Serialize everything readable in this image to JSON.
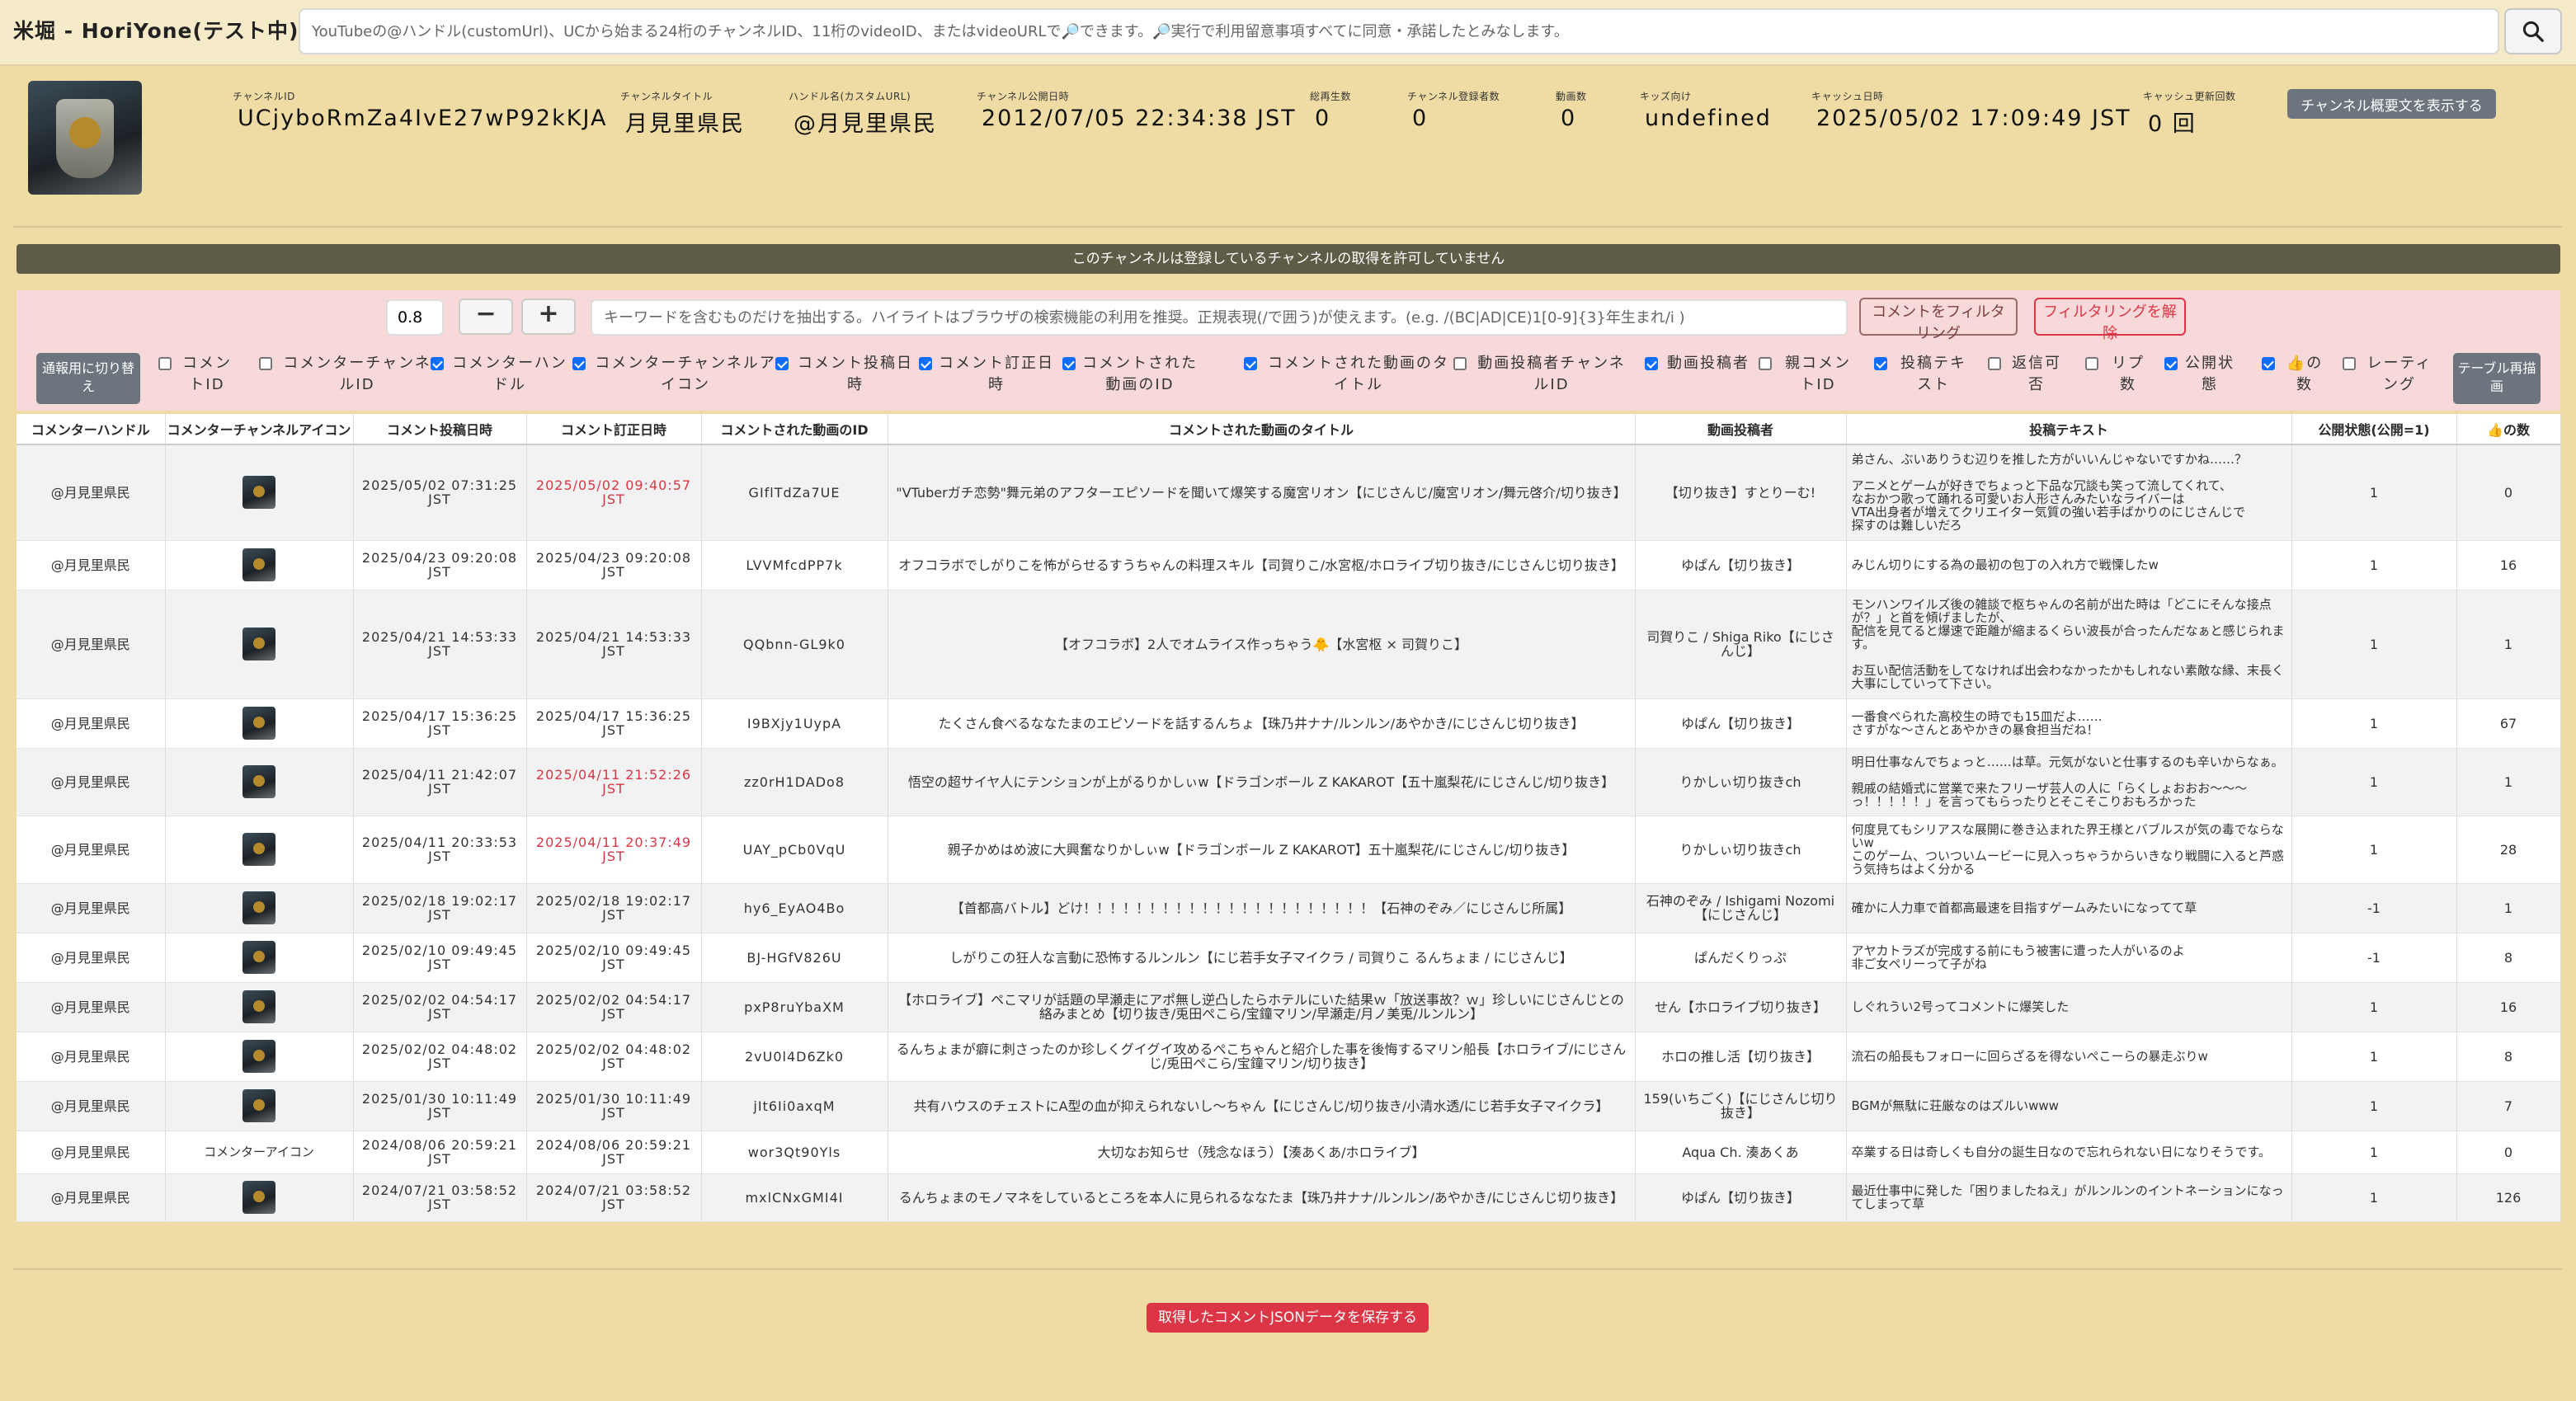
{
  "app": {
    "title": "米堀 - HoriYone(テスト中)"
  },
  "search": {
    "placeholder": "YouTubeの@ハンドル(customUrl)、UCから始まる24桁のチャンネルID、11桁のvideoID、またはvideoURLで🔎できます。🔎実行で利用留意事項すべてに同意・承諾したとみなします。",
    "button_icon": "search-icon"
  },
  "channel": {
    "avatar_icon": "channel-avatar",
    "fields": [
      {
        "label": "チャンネルID",
        "value": "UCjyboRmZa4IvE27wP92kKJA"
      },
      {
        "label": "チャンネルタイトル",
        "value": "月見里県民"
      },
      {
        "label": "ハンドル名(カスタムURL)",
        "value": "@月見里県民"
      },
      {
        "label": "チャンネル公開日時",
        "value": "2012/07/05 22:34:38 JST"
      },
      {
        "label": "総再生数",
        "value": "0"
      },
      {
        "label": "チャンネル登録者数",
        "value": "0"
      },
      {
        "label": "動画数",
        "value": "0"
      },
      {
        "label": "キッズ向け",
        "value": "undefined"
      },
      {
        "label": "キャッシュ日時",
        "value": "2025/05/02 17:09:49 JST"
      },
      {
        "label": "キャッシュ更新回数",
        "value": "0 回"
      }
    ],
    "overview_button": "チャンネル概要文を表示する"
  },
  "notice": "このチャンネルは登録しているチャンネルの取得を許可していません",
  "filter": {
    "ratio_value": "0.8",
    "minus_label": "−",
    "plus_label": "+",
    "keyword_placeholder": "キーワードを含むものだけを抽出する。ハイライトはブラウザの検索機能の利用を推奨。正規表現(/で囲う)が使えます。(e.g. /(BC|AD|CE)1[0-9]{3}年生まれ/i )",
    "apply_button": "コメントをフィルタリング",
    "clear_button": "フィルタリングを解除",
    "mobile_button": "通報用に切り替え",
    "redraw_button": "テーブル再描画"
  },
  "column_toggles": [
    {
      "label": "コメントID",
      "checked": false
    },
    {
      "label": "コメンターチャンネルID",
      "checked": false
    },
    {
      "label": "コメンターハンドル",
      "checked": true
    },
    {
      "label": "コメンターチャンネルアイコン",
      "checked": true
    },
    {
      "label": "コメント投稿日時",
      "checked": true
    },
    {
      "label": "コメント訂正日時",
      "checked": true
    },
    {
      "label": "コメントされた動画のID",
      "checked": true
    },
    {
      "label": "コメントされた動画のタイトル",
      "checked": true
    },
    {
      "label": "動画投稿者チャンネルID",
      "checked": false
    },
    {
      "label": "動画投稿者",
      "checked": true
    },
    {
      "label": "親コメントID",
      "checked": false
    },
    {
      "label": "投稿テキスト",
      "checked": true
    },
    {
      "label": "返信可否",
      "checked": false
    },
    {
      "label": "リプ数",
      "checked": false
    },
    {
      "label": "公開状態",
      "checked": true
    },
    {
      "label": "👍の数",
      "checked": true
    },
    {
      "label": "レーティング",
      "checked": false
    }
  ],
  "table": {
    "headers": [
      "コメンターハンドル",
      "コメンターチャンネルアイコン",
      "コメント投稿日時",
      "コメント訂正日時",
      "コメントされた動画のID",
      "コメントされた動画のタイトル",
      "動画投稿者",
      "投稿テキスト",
      "公開状態(公開=1)",
      "👍の数"
    ],
    "rows": [
      {
        "handle": "@月見里県民",
        "icon": "commenter-icon",
        "posted": "2025/05/02 07:31:25 JST",
        "edited": "2025/05/02 09:40:57 JST",
        "edited_changed": true,
        "video_id": "GIflTdZa7UE",
        "title": "\"VTuberガチ恋勢\"舞元弟のアフターエピソードを聞いて爆笑する魔宮リオン【にじさんじ/魔宮リオン/舞元啓介/切り抜き】",
        "uploader": "【切り抜き】すとりーむ!",
        "text": "弟さん、ぶいありうむ辺りを推した方がいいんじゃないですかね……？\n\nアニメとゲームが好きでちょっと下品な冗談も笑って流してくれて、\nなおかつ歌って踊れる可愛いお人形さんみたいなライバーは\nVTA出身者が増えてクリエイター気質の強い若手ばかりのにじさんじで\n探すのは難しいだろ",
        "status": "1",
        "likes": "0"
      },
      {
        "handle": "@月見里県民",
        "icon": "commenter-icon",
        "posted": "2025/04/23 09:20:08 JST",
        "edited": "2025/04/23 09:20:08 JST",
        "edited_changed": false,
        "video_id": "LVVMfcdPP7k",
        "title": "オフコラボでしがりこを怖がらせるすうちゃんの料理スキル【司賀りこ/水宮枢/ホロライブ切り抜き/にじさんじ切り抜き】",
        "uploader": "ゆぱん【切り抜き】",
        "text": "みじん切りにする為の最初の包丁の入れ方で戦慄したw",
        "status": "1",
        "likes": "16"
      },
      {
        "handle": "@月見里県民",
        "icon": "commenter-icon",
        "posted": "2025/04/21 14:53:33 JST",
        "edited": "2025/04/21 14:53:33 JST",
        "edited_changed": false,
        "video_id": "QQbnn-GL9k0",
        "title": "【オフコラボ】2人でオムライス作っちゃう🐥【水宮枢 × 司賀りこ】",
        "uploader": "司賀りこ / Shiga Riko【にじさんじ】",
        "text": "モンハンワイルズ後の雑談で枢ちゃんの名前が出た時は「どこにそんな接点が？」と首を傾げましたが、\n配信を見てると爆速で距離が縮まるくらい波長が合ったんだなぁと感じられます。\n\nお互い配信活動をしてなければ出会わなかったかもしれない素敵な縁、末長く大事にしていって下さい。",
        "status": "1",
        "likes": "1"
      },
      {
        "handle": "@月見里県民",
        "icon": "commenter-icon",
        "posted": "2025/04/17 15:36:25 JST",
        "edited": "2025/04/17 15:36:25 JST",
        "edited_changed": false,
        "video_id": "I9BXjy1UypA",
        "title": "たくさん食べるななたまのエピソードを話するんちょ【珠乃井ナナ/ルンルン/あやかき/にじさんじ切り抜き】",
        "uploader": "ゆぱん【切り抜き】",
        "text": "一番食べられた高校生の時でも15皿だよ……\nさすがな～さんとあやかきの暴食担当だね！",
        "status": "1",
        "likes": "67"
      },
      {
        "handle": "@月見里県民",
        "icon": "commenter-icon",
        "posted": "2025/04/11 21:42:07 JST",
        "edited": "2025/04/11 21:52:26 JST",
        "edited_changed": true,
        "video_id": "zz0rH1DADo8",
        "title": "悟空の超サイヤ人にテンションが上がるりかしぃw【ドラゴンボール Z KAKAROT【五十嵐梨花/にじさんじ/切り抜き】",
        "uploader": "りかしぃ切り抜きch",
        "text": "明日仕事なんでちょっと……は草。元気がないと仕事するのも辛いからなぁ。\n\n親戚の結婚式に営業で来たフリーザ芸人の人に「らくしょおおお～～～っ！！！！！」を言ってもらったりとそこそこりおもろかった",
        "status": "1",
        "likes": "1"
      },
      {
        "handle": "@月見里県民",
        "icon": "commenter-icon",
        "posted": "2025/04/11 20:33:53 JST",
        "edited": "2025/04/11 20:37:49 JST",
        "edited_changed": true,
        "video_id": "UAY_pCb0VqU",
        "title": "親子かめはめ波に大興奮なりかしぃw【ドラゴンボール Z KAKAROT】五十嵐梨花/にじさんじ/切り抜き】",
        "uploader": "りかしぃ切り抜きch",
        "text": "何度見てもシリアスな展開に巻き込まれた界王様とバブルスが気の毒でならないw\nこのゲーム、ついついムービーに見入っちゃうからいきなり戦闘に入ると芦惑う気持ちはよく分かる",
        "status": "1",
        "likes": "28"
      },
      {
        "handle": "@月見里県民",
        "icon": "commenter-icon",
        "posted": "2025/02/18 19:02:17 JST",
        "edited": "2025/02/18 19:02:17 JST",
        "edited_changed": false,
        "video_id": "hy6_EyAO4Bo",
        "title": "【首都高バトル】どけ！！！！！！！！！！！！！！！！！！！！！！【石神のぞみ／にじさんじ所属】",
        "uploader": "石神のぞみ / Ishigami Nozomi【にじさんじ】",
        "text": "確かに人力車で首都高最速を目指すゲームみたいになってて草",
        "status": "-1",
        "likes": "1"
      },
      {
        "handle": "@月見里県民",
        "icon": "commenter-icon",
        "posted": "2025/02/10 09:49:45 JST",
        "edited": "2025/02/10 09:49:45 JST",
        "edited_changed": false,
        "video_id": "BJ-HGfV826U",
        "title": "しがりこの狂人な言動に恐怖するルンルン【にじ若手女子マイクラ / 司賀りこ るんちょま / にじさんじ】",
        "uploader": "ぱんだくりっぷ",
        "text": "アヤカトラズが完成する前にもう被害に遭った人がいるのよ\n非ご女ペリーって子がね",
        "status": "-1",
        "likes": "8"
      },
      {
        "handle": "@月見里県民",
        "icon": "commenter-icon",
        "posted": "2025/02/02 04:54:17 JST",
        "edited": "2025/02/02 04:54:17 JST",
        "edited_changed": false,
        "video_id": "pxP8ruYbaXM",
        "title": "【ホロライブ】ペこマリが話題の早瀬走にアポ無し逆凸したらホテルにいた結果ｗ「放送事故？ｗ」珍しいにじさんじとの絡みまとめ【切り抜き/兎田ぺこら/宝鐘マリン/早瀬走/月ノ美兎/ルンルン】",
        "uploader": "せん【ホロライブ切り抜き】",
        "text": "しぐれうい2号ってコメントに爆笑した",
        "status": "1",
        "likes": "16"
      },
      {
        "handle": "@月見里県民",
        "icon": "commenter-icon",
        "posted": "2025/02/02 04:48:02 JST",
        "edited": "2025/02/02 04:48:02 JST",
        "edited_changed": false,
        "video_id": "2vU0l4D6Zk0",
        "title": "るんちょまが癖に刺さったのか珍しくグイグイ攻めるぺこちゃんと紹介した事を後悔するマリン船長【ホロライブ/にじさんじ/兎田ぺこら/宝鐘マリン/切り抜き】",
        "uploader": "ホロの推し活【切り抜き】",
        "text": "流石の船長もフォローに回らざるを得ないぺこーらの暴走ぶりw",
        "status": "1",
        "likes": "8"
      },
      {
        "handle": "@月見里県民",
        "icon": "commenter-icon",
        "posted": "2025/01/30 10:11:49 JST",
        "edited": "2025/01/30 10:11:49 JST",
        "edited_changed": false,
        "video_id": "jIt6Ii0axqM",
        "title": "共有ハウスのチェストにA型の血が抑えられないし～ちゃん【にじさんじ/切り抜き/小清水透/にじ若手女子マイクラ】",
        "uploader": "159(いちごく)【にじさんじ切り抜き】",
        "text": "BGMが無駄に荘厳なのはズルいwww",
        "status": "1",
        "likes": "7"
      },
      {
        "handle": "@月見里県民",
        "icon": "broken-image",
        "posted": "2024/08/06 20:59:21 JST",
        "edited": "2024/08/06 20:59:21 JST",
        "edited_changed": false,
        "video_id": "wor3Qt90Yls",
        "title": "大切なお知らせ（残念なほう）【湊あくあ/ホロライブ】",
        "uploader": "Aqua Ch. 湊あくあ",
        "text": "卒業する日は奇しくも自分の誕生日なので忘れられない日になりそうです。",
        "status": "1",
        "likes": "0",
        "icon_alt": "コメンターアイコン"
      },
      {
        "handle": "@月見里県民",
        "icon": "commenter-icon",
        "posted": "2024/07/21 03:58:52 JST",
        "edited": "2024/07/21 03:58:52 JST",
        "edited_changed": false,
        "video_id": "mxlCNxGMI4I",
        "title": "るんちょまのモノマネをしているところを本人に見られるななたま【珠乃井ナナ/ルンルン/あやかき/にじさんじ切り抜き】",
        "uploader": "ゆぱん【切り抜き】",
        "text": "最近仕事中に発した「困りましたねえ」がルンルンのイントネーションになってしまって草",
        "status": "1",
        "likes": "126"
      }
    ]
  },
  "save_button": "取得したコメントJSONデータを保存する"
}
